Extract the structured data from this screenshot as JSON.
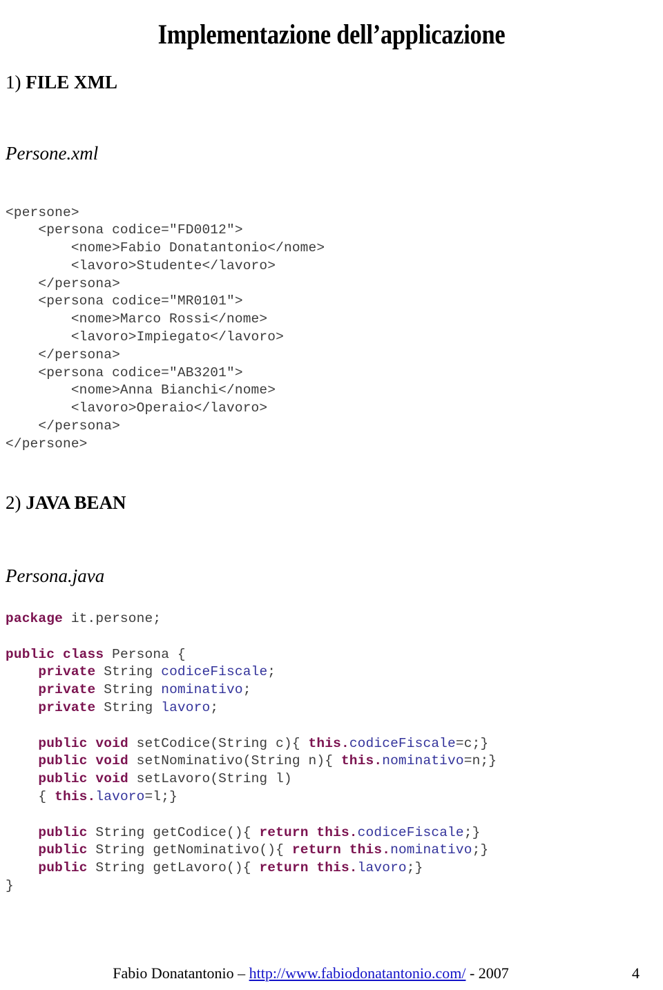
{
  "title": "Implementazione dell’applicazione",
  "sections": [
    {
      "heading_num": "1)",
      "heading_text": " FILE XML",
      "file_name": "Persone.xml",
      "code_type": "xml"
    },
    {
      "heading_num": "2)",
      "heading_text": " JAVA BEAN",
      "file_name": "Persona.java",
      "code_type": "java"
    }
  ],
  "xml_code": "<persone>\n    <persona codice=\"FD0012\">\n        <nome>Fabio Donatantonio</nome>\n        <lavoro>Studente</lavoro>\n    </persona>\n    <persona codice=\"MR0101\">\n        <nome>Marco Rossi</nome>\n        <lavoro>Impiegato</lavoro>\n    </persona>\n    <persona codice=\"AB3201\">\n        <nome>Anna Bianchi</nome>\n        <lavoro>Operaio</lavoro>\n    </persona>\n</persone>",
  "java_code_lines": [
    [
      {
        "t": "package",
        "c": "kw"
      },
      {
        "t": " it.persone;",
        "c": "plain"
      }
    ],
    [
      {
        "t": "",
        "c": "plain"
      }
    ],
    [
      {
        "t": "public class",
        "c": "kw"
      },
      {
        "t": " Persona {",
        "c": "plain"
      }
    ],
    [
      {
        "t": "    ",
        "c": "plain"
      },
      {
        "t": "private",
        "c": "kw"
      },
      {
        "t": " String ",
        "c": "plain"
      },
      {
        "t": "codiceFiscale",
        "c": "ident"
      },
      {
        "t": ";",
        "c": "plain"
      }
    ],
    [
      {
        "t": "    ",
        "c": "plain"
      },
      {
        "t": "private",
        "c": "kw"
      },
      {
        "t": " String ",
        "c": "plain"
      },
      {
        "t": "nominativo",
        "c": "ident"
      },
      {
        "t": ";",
        "c": "plain"
      }
    ],
    [
      {
        "t": "    ",
        "c": "plain"
      },
      {
        "t": "private",
        "c": "kw"
      },
      {
        "t": " String ",
        "c": "plain"
      },
      {
        "t": "lavoro",
        "c": "ident"
      },
      {
        "t": ";",
        "c": "plain"
      }
    ],
    [
      {
        "t": "",
        "c": "plain"
      }
    ],
    [
      {
        "t": "    ",
        "c": "plain"
      },
      {
        "t": "public void",
        "c": "kw"
      },
      {
        "t": " setCodice(String c){ ",
        "c": "plain"
      },
      {
        "t": "this.",
        "c": "kw"
      },
      {
        "t": "codiceFiscale",
        "c": "ident"
      },
      {
        "t": "=c;}",
        "c": "plain"
      }
    ],
    [
      {
        "t": "    ",
        "c": "plain"
      },
      {
        "t": "public void",
        "c": "kw"
      },
      {
        "t": " setNominativo(String n){ ",
        "c": "plain"
      },
      {
        "t": "this.",
        "c": "kw"
      },
      {
        "t": "nominativo",
        "c": "ident"
      },
      {
        "t": "=n;}",
        "c": "plain"
      }
    ],
    [
      {
        "t": "    ",
        "c": "plain"
      },
      {
        "t": "public void",
        "c": "kw"
      },
      {
        "t": " setLavoro(String l)",
        "c": "plain"
      }
    ],
    [
      {
        "t": "    { ",
        "c": "plain"
      },
      {
        "t": "this.",
        "c": "kw"
      },
      {
        "t": "lavoro",
        "c": "ident"
      },
      {
        "t": "=l;}",
        "c": "plain"
      }
    ],
    [
      {
        "t": "",
        "c": "plain"
      }
    ],
    [
      {
        "t": "    ",
        "c": "plain"
      },
      {
        "t": "public",
        "c": "kw"
      },
      {
        "t": " String getCodice(){ ",
        "c": "plain"
      },
      {
        "t": "return this.",
        "c": "kw"
      },
      {
        "t": "codiceFiscale",
        "c": "ident"
      },
      {
        "t": ";}",
        "c": "plain"
      }
    ],
    [
      {
        "t": "    ",
        "c": "plain"
      },
      {
        "t": "public",
        "c": "kw"
      },
      {
        "t": " String getNominativo(){ ",
        "c": "plain"
      },
      {
        "t": "return this.",
        "c": "kw"
      },
      {
        "t": "nominativo",
        "c": "ident"
      },
      {
        "t": ";}",
        "c": "plain"
      }
    ],
    [
      {
        "t": "    ",
        "c": "plain"
      },
      {
        "t": "public",
        "c": "kw"
      },
      {
        "t": " String getLavoro(){ ",
        "c": "plain"
      },
      {
        "t": "return this.",
        "c": "kw"
      },
      {
        "t": "lavoro",
        "c": "ident"
      },
      {
        "t": ";}",
        "c": "plain"
      }
    ],
    [
      {
        "t": "}",
        "c": "plain"
      }
    ]
  ],
  "footer": {
    "author": "Fabio Donatantonio – ",
    "link": "http://www.fabiodonatantonio.com/",
    "year": " - 2007",
    "page_number": "4"
  },
  "colors": {
    "keyword": "#7B1350",
    "identifier": "#33339B",
    "code_plain": "#3b3b3b",
    "link": "#1212C8",
    "text": "#000000",
    "background": "#ffffff"
  }
}
